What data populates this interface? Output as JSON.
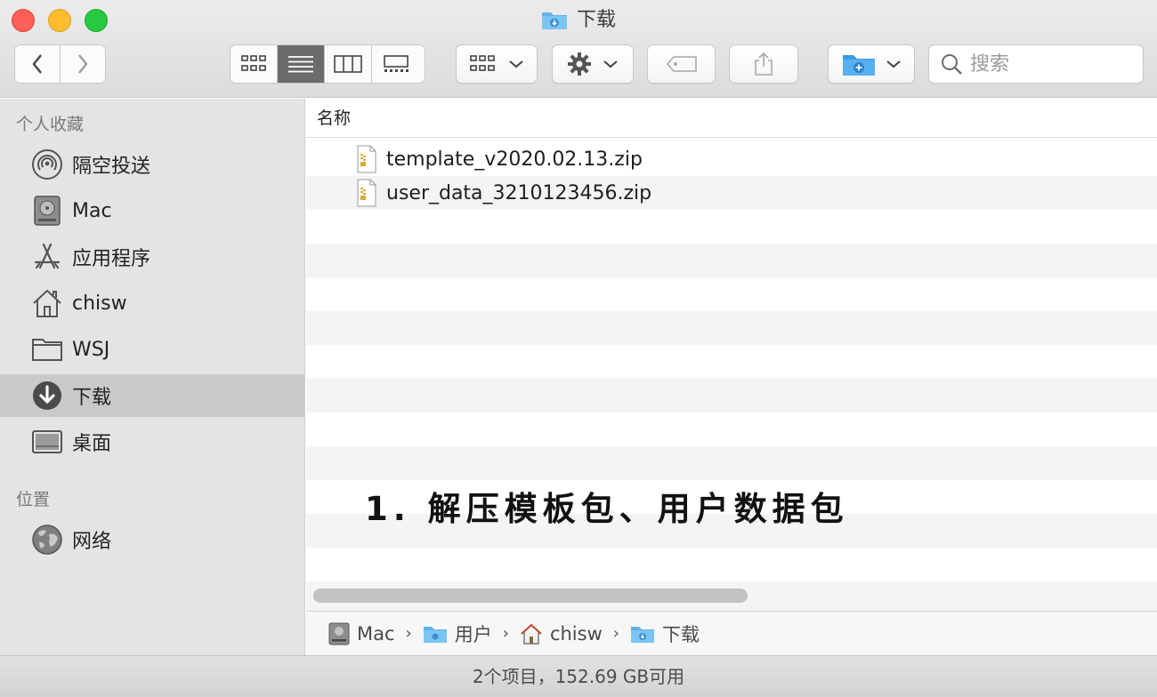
{
  "window": {
    "title": "下载"
  },
  "search": {
    "placeholder": "搜索"
  },
  "sidebar": {
    "favorites_header": "个人收藏",
    "locations_header": "位置",
    "favorites": [
      {
        "label": "隔空投送",
        "icon": "airdrop-icon"
      },
      {
        "label": "Mac",
        "icon": "hard-drive-icon"
      },
      {
        "label": "应用程序",
        "icon": "applications-icon"
      },
      {
        "label": "chisw",
        "icon": "home-icon"
      },
      {
        "label": "WSJ",
        "icon": "folder-icon"
      },
      {
        "label": "下载",
        "icon": "downloads-icon",
        "selected": true
      },
      {
        "label": "桌面",
        "icon": "desktop-icon"
      }
    ],
    "locations": [
      {
        "label": "网络",
        "icon": "network-globe-icon"
      }
    ]
  },
  "list": {
    "column_name": "名称",
    "files": [
      {
        "name": "template_v2020.02.13.zip",
        "icon": "zip-file-icon"
      },
      {
        "name": "user_data_3210123456.zip",
        "icon": "zip-file-icon"
      }
    ]
  },
  "overlay": {
    "text": "1. 解压模板包、用户数据包"
  },
  "pathbar": {
    "crumbs": [
      {
        "label": "Mac",
        "icon": "hard-drive-icon"
      },
      {
        "label": "用户",
        "icon": "folder-icon"
      },
      {
        "label": "chisw",
        "icon": "home-icon"
      },
      {
        "label": "下载",
        "icon": "downloads-folder-icon"
      }
    ]
  },
  "status": {
    "text": "2个项目，152.69 GB可用"
  },
  "colors": {
    "selected_row": "#c9c9c9",
    "folder_blue": "#5fb1ea",
    "active_segment": "#6b6b6b"
  }
}
